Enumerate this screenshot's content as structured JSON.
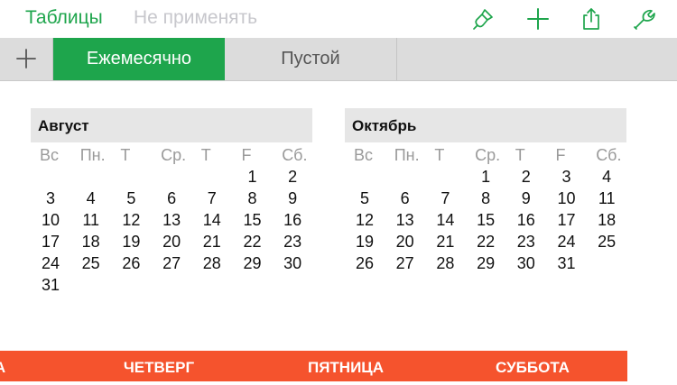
{
  "toolbar": {
    "back_label": "Таблицы",
    "undo_label": "Не применять",
    "icons": [
      "format-brush-icon",
      "add-icon",
      "share-icon",
      "settings-wrench-icon"
    ],
    "accent_color": "#1ea54c"
  },
  "tabs": {
    "items": [
      {
        "label": "Ежемесячно",
        "active": true
      },
      {
        "label": "Пустой",
        "active": false
      }
    ]
  },
  "calendars": [
    {
      "month": "Август",
      "weekdays": [
        "Вс",
        "Пн.",
        "Т",
        "Ср.",
        "Т",
        "F",
        "Сб."
      ],
      "weeks": [
        [
          "",
          "",
          "",
          "",
          "",
          "1",
          "2"
        ],
        [
          "3",
          "4",
          "5",
          "6",
          "7",
          "8",
          "9"
        ],
        [
          "10",
          "11",
          "12",
          "13",
          "14",
          "15",
          "16"
        ],
        [
          "17",
          "18",
          "19",
          "20",
          "21",
          "22",
          "23"
        ],
        [
          "24",
          "25",
          "26",
          "27",
          "28",
          "29",
          "30"
        ],
        [
          "31",
          "",
          "",
          "",
          "",
          "",
          ""
        ]
      ]
    },
    {
      "month": "Октябрь",
      "weekdays": [
        "Вс",
        "Пн.",
        "Т",
        "Ср.",
        "Т",
        "F",
        "Сб."
      ],
      "weeks": [
        [
          "",
          "",
          "",
          "1",
          "2",
          "3",
          "4"
        ],
        [
          "5",
          "6",
          "7",
          "8",
          "9",
          "10",
          "11"
        ],
        [
          "12",
          "13",
          "14",
          "15",
          "16",
          "17",
          "18"
        ],
        [
          "19",
          "20",
          "21",
          "22",
          "23",
          "24",
          "25"
        ],
        [
          "26",
          "27",
          "28",
          "29",
          "30",
          "31",
          ""
        ]
      ]
    }
  ],
  "bottom_bar": {
    "color": "#f5532d",
    "labels": [
      "А",
      "ЧЕТВЕРГ",
      "ПЯТНИЦА",
      "СУББОТА"
    ]
  }
}
